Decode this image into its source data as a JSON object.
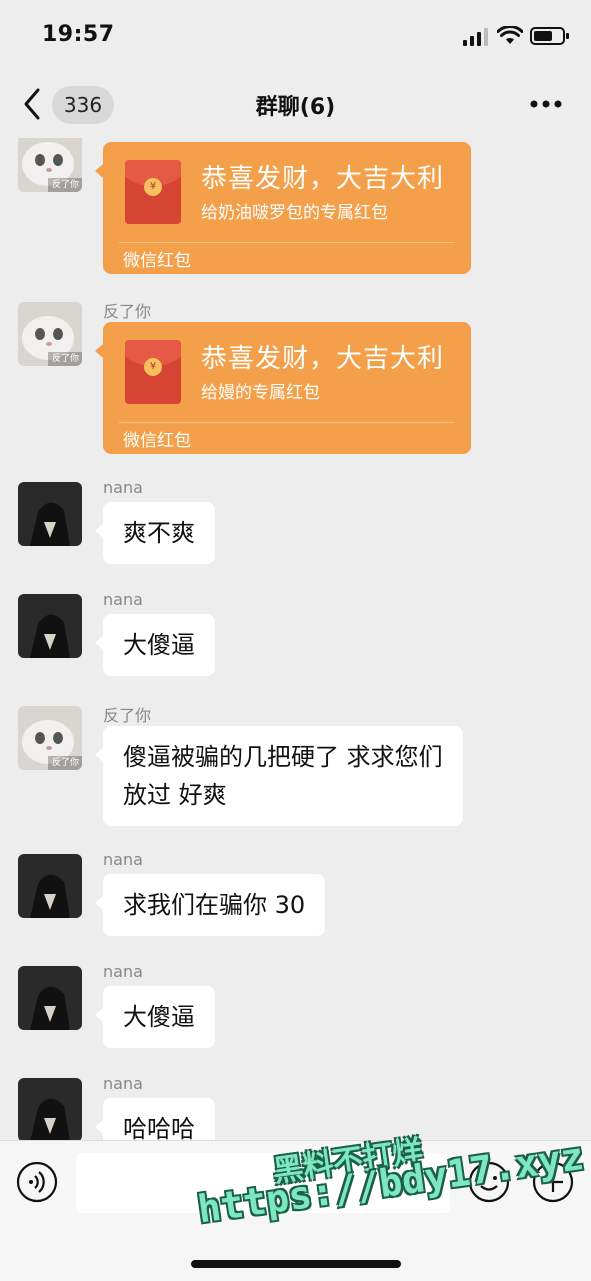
{
  "status_bar": {
    "time": "19:57"
  },
  "header": {
    "back_count": "336",
    "title": "群聊(6)"
  },
  "messages": [
    {
      "type": "redpacket",
      "sender": "",
      "avatar": "cat-avatar",
      "title": "恭喜发财，大吉大利",
      "subtitle": "给奶油啵罗包的专属红包",
      "footer": "微信红包"
    },
    {
      "type": "redpacket",
      "sender": "反了你",
      "avatar": "cat-avatar",
      "title": "恭喜发财，大吉大利",
      "subtitle": "给嫚的专属红包",
      "footer": "微信红包"
    },
    {
      "type": "text",
      "sender": "nana",
      "avatar": "dark-avatar",
      "text": "爽不爽"
    },
    {
      "type": "text",
      "sender": "nana",
      "avatar": "dark-avatar",
      "text": "大傻逼"
    },
    {
      "type": "text",
      "sender": "反了你",
      "avatar": "cat-avatar",
      "text_line1": "傻逼被骗的几把硬了 求求您们",
      "text_line2": "放过 好爽"
    },
    {
      "type": "text",
      "sender": "nana",
      "avatar": "dark-avatar",
      "text": "求我们在骗你 30"
    },
    {
      "type": "text",
      "sender": "nana",
      "avatar": "dark-avatar",
      "text": "大傻逼"
    },
    {
      "type": "text",
      "sender": "nana",
      "avatar": "dark-avatar",
      "text": "哈哈哈"
    }
  ],
  "avatars": {
    "cat_label": "反了你"
  },
  "watermark": {
    "line1": "黑料不打烊",
    "line2": "https://bdy17.xyz"
  },
  "colors": {
    "background": "#ededed",
    "redpacket": "#f4a04a",
    "bubble": "#ffffff"
  },
  "icons": [
    "back-chevron-icon",
    "more-dots-icon",
    "voice-icon",
    "emoji-icon",
    "plus-icon"
  ]
}
